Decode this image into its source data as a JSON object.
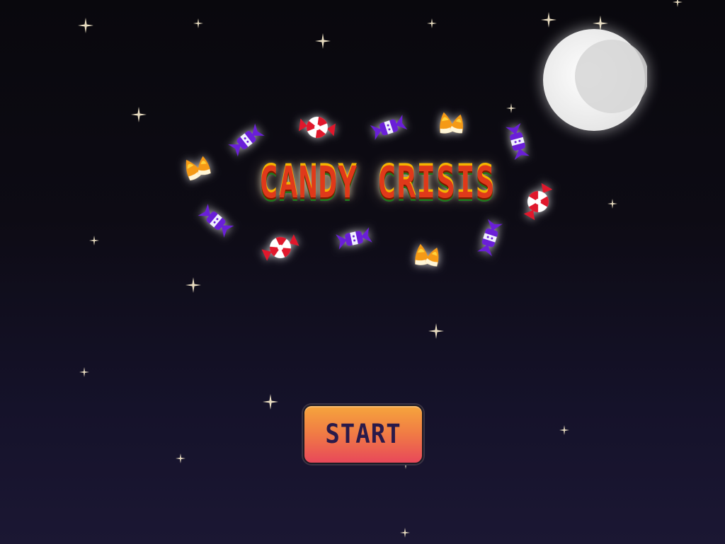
{
  "game": {
    "title": "CANDY CRISIS",
    "start_button_label": "START"
  },
  "colors": {
    "sky_top": "#09080d",
    "sky_bottom": "#1b1733",
    "title_fill": "#e0391a",
    "title_highlight": "#f4b400",
    "title_shadow": "#1f7a1f",
    "button_top": "#f6a53c",
    "button_bottom": "#e8485a",
    "button_text": "#2a1a4a",
    "peppermint": "#e0182c",
    "wrapped_candy": "#6a1fd8",
    "candy_corn_orange": "#f59a16",
    "candy_corn_yellow": "#ffd23a"
  },
  "decor": {
    "moon_icon": "crescent-moon-icon",
    "star_icon": "sparkle-star-icon",
    "candy_icons": [
      "peppermint-candy-icon",
      "wrapped-candy-icon",
      "candy-corn-icon"
    ]
  }
}
